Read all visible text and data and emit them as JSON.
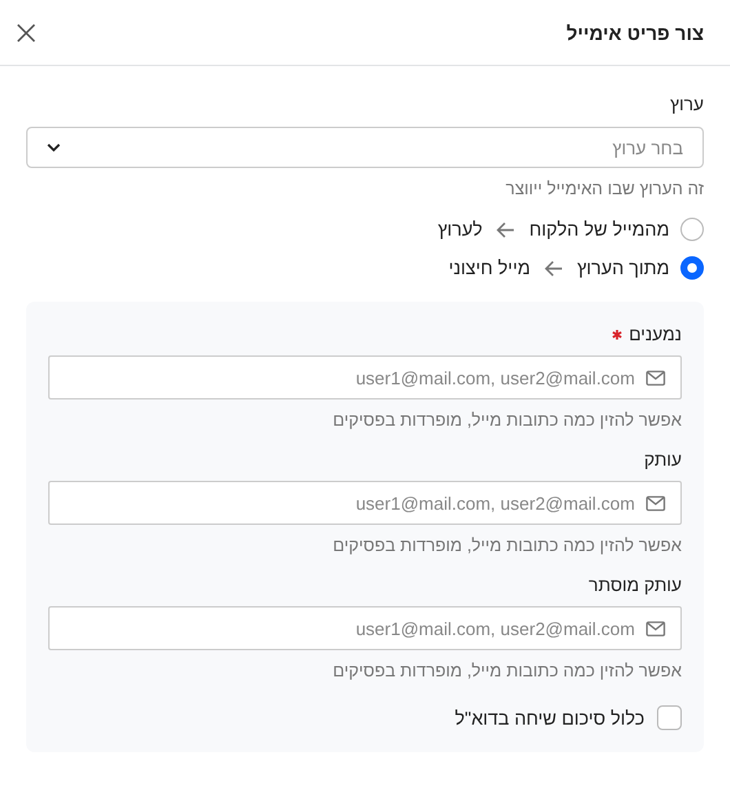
{
  "dialog": {
    "title": "צור פריט אימייל"
  },
  "channel": {
    "label": "ערוץ",
    "placeholder": "בחר ערוץ",
    "help": "זה הערוץ שבו האימייל ייווצר"
  },
  "directions": [
    {
      "from": "מהמייל של הלקוח",
      "to": "לערוץ",
      "selected": false
    },
    {
      "from": "מתוך הערוץ",
      "to": "מייל חיצוני",
      "selected": true
    }
  ],
  "recipients": [
    {
      "label": "נמענים",
      "required": true,
      "placeholder": "user1@mail.com, user2@mail.com",
      "help": "אפשר להזין כמה כתובות מייל, מופרדות בפסיקים"
    },
    {
      "label": "עותק",
      "required": false,
      "placeholder": "user1@mail.com, user2@mail.com",
      "help": "אפשר להזין כמה כתובות מייל, מופרדות בפסיקים"
    },
    {
      "label": "עותק מוסתר",
      "required": false,
      "placeholder": "user1@mail.com, user2@mail.com",
      "help": "אפשר להזין כמה כתובות מייל, מופרדות בפסיקים"
    }
  ],
  "summary": {
    "label": "כלול סיכום שיחה בדוא\"ל",
    "checked": false
  }
}
